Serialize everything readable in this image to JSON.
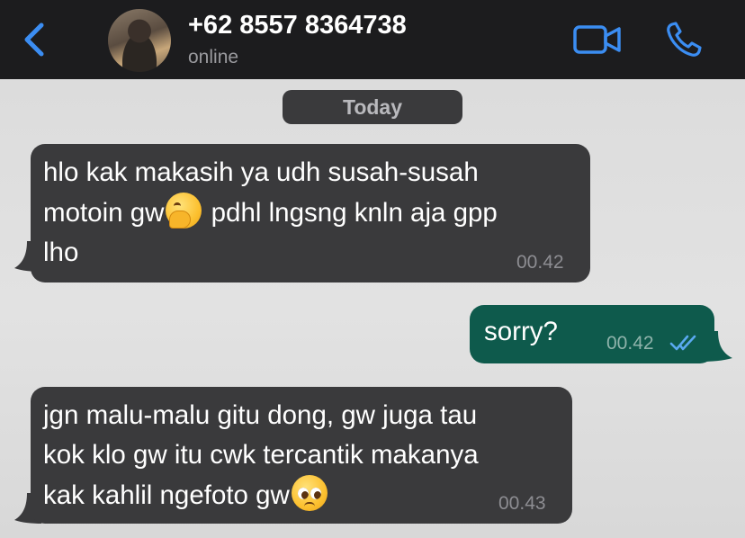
{
  "header": {
    "contact_name": "+62 8557 8364738",
    "status": "online",
    "accent_color": "#3b8df2"
  },
  "chat": {
    "date_separator": "Today",
    "messages": [
      {
        "direction": "incoming",
        "lines": [
          "hlo kak makasih ya udh susah-susah",
          "motoin gw",
          " pdhl lngsng knln aja gpp",
          "lho"
        ],
        "emoji": "hand-over-mouth-emoji",
        "time": "00.42"
      },
      {
        "direction": "outgoing",
        "lines": [
          "sorry?"
        ],
        "time": "00.42",
        "status": "read"
      },
      {
        "direction": "incoming",
        "lines": [
          "jgn malu-malu gitu dong, gw juga tau",
          "kok klo gw itu cwk tercantik makanya",
          "kak kahlil ngefoto gw"
        ],
        "emoji": "pleading-face-emoji",
        "time": "00.43"
      }
    ]
  }
}
